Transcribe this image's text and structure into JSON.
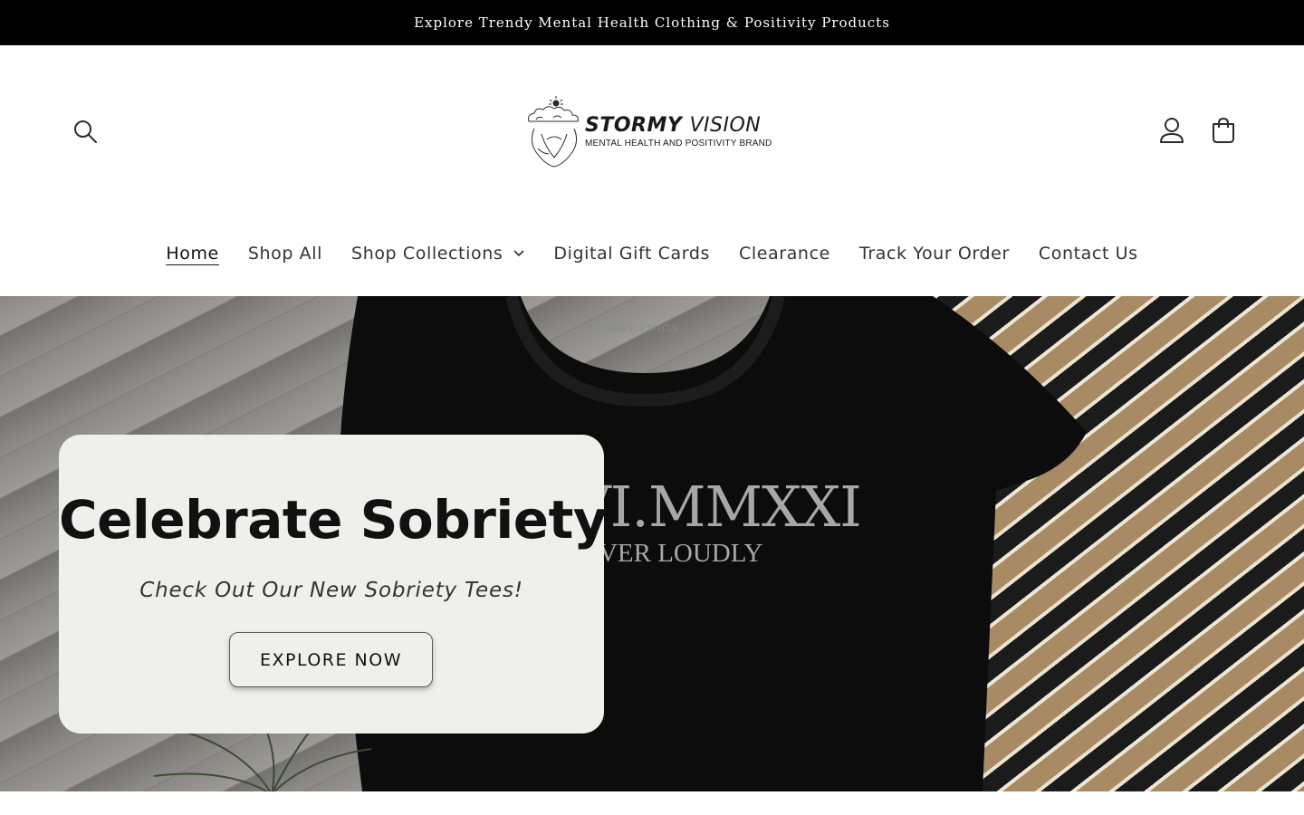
{
  "announcement": {
    "text": "Explore Trendy Mental Health Clothing & Positivity Products"
  },
  "header": {
    "logo": {
      "title_bold": "STORMY",
      "title_light": "VISION",
      "subtitle": "MENTAL HEALTH AND POSITIVITY BRAND"
    },
    "icons": {
      "search": "search-icon",
      "account": "account-icon",
      "cart": "cart-icon"
    }
  },
  "nav": {
    "items": [
      {
        "label": "Home",
        "active": true
      },
      {
        "label": "Shop All"
      },
      {
        "label": "Shop Collections",
        "has_dropdown": true
      },
      {
        "label": "Digital Gift Cards"
      },
      {
        "label": "Clearance"
      },
      {
        "label": "Track Your Order"
      },
      {
        "label": "Contact Us"
      }
    ]
  },
  "hero": {
    "heading": "Celebrate Sobriety",
    "subheading": "Check Out Our New Sobriety Tees!",
    "button_label": "EXPLORE NOW",
    "shirt_print": {
      "line1": "VI.MMXXI",
      "line2": "OVER LOUDLY",
      "brand": "STORMY VISION"
    }
  },
  "colors": {
    "announcement_bg": "#000000",
    "card_bg": "#eff0ec",
    "text": "#111111"
  }
}
